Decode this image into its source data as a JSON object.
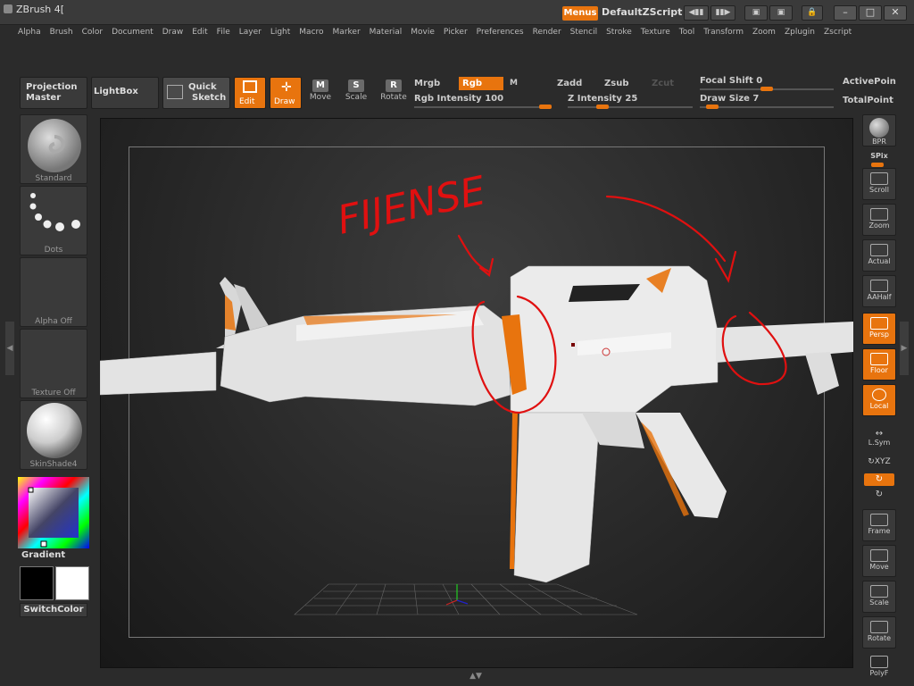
{
  "app": {
    "title": "ZBrush 4[",
    "menus_label": "Menus",
    "script_name": "DefaultZScript"
  },
  "menus": [
    "Alpha",
    "Brush",
    "Color",
    "Document",
    "Draw",
    "Edit",
    "File",
    "Layer",
    "Light",
    "Macro",
    "Marker",
    "Material",
    "Movie",
    "Picker",
    "Preferences",
    "Render",
    "Stencil",
    "Stroke",
    "Texture",
    "Tool",
    "Transform",
    "Zoom",
    "Zplugin",
    "Zscript"
  ],
  "toolbar": {
    "projection_master": "Projection Master",
    "lightbox": "LightBox",
    "quick_sketch_line1": "Quick",
    "quick_sketch_line2": "Sketch",
    "edit": "Edit",
    "draw": "Draw",
    "move": "Move",
    "scale": "Scale",
    "rotate": "Rotate",
    "move_glyph": "M",
    "scale_glyph": "S",
    "rotate_glyph": "R",
    "mrgb": "Mrgb",
    "rgb": "Rgb",
    "m": "M",
    "zadd": "Zadd",
    "zsub": "Zsub",
    "zcut": "Zcut",
    "rgb_intensity_label": "Rgb  Intensity",
    "rgb_intensity_value": "100",
    "rgb_intensity_frac": 1.0,
    "z_intensity_label": "Z  Intensity",
    "z_intensity_value": "25",
    "z_intensity_frac": 0.25,
    "focal_shift_label": "Focal  Shift",
    "focal_shift_value": "0",
    "focal_shift_frac": 0.5,
    "draw_size_label": "Draw  Size",
    "draw_size_value": "7",
    "draw_size_frac": 0.05,
    "active_points": "ActivePoin",
    "total_points": "TotalPoint"
  },
  "left_panel": {
    "brush": "Standard",
    "stroke": "Dots",
    "alpha": "Alpha  Off",
    "texture": "Texture  Off",
    "material": "SkinShade4",
    "gradient": "Gradient",
    "switch_color": "SwitchColor"
  },
  "right_panel": {
    "bpr": "BPR",
    "spix": "SPix",
    "scroll": "Scroll",
    "zoom": "Zoom",
    "actual": "Actual",
    "aahalf": "AAHalf",
    "persp": "Persp",
    "floor": "Floor",
    "local": "Local",
    "lsym": "L.Sym",
    "xyz": "XYZ",
    "frame": "Frame",
    "move": "Move",
    "scale": "Scale",
    "rotate": "Rotate",
    "polyf": "PolyF"
  },
  "annotation": {
    "text": "FIJENSE"
  },
  "colors": {
    "accent": "#e8740e",
    "annotation": "#e01010",
    "model": "#e9e9e9"
  }
}
